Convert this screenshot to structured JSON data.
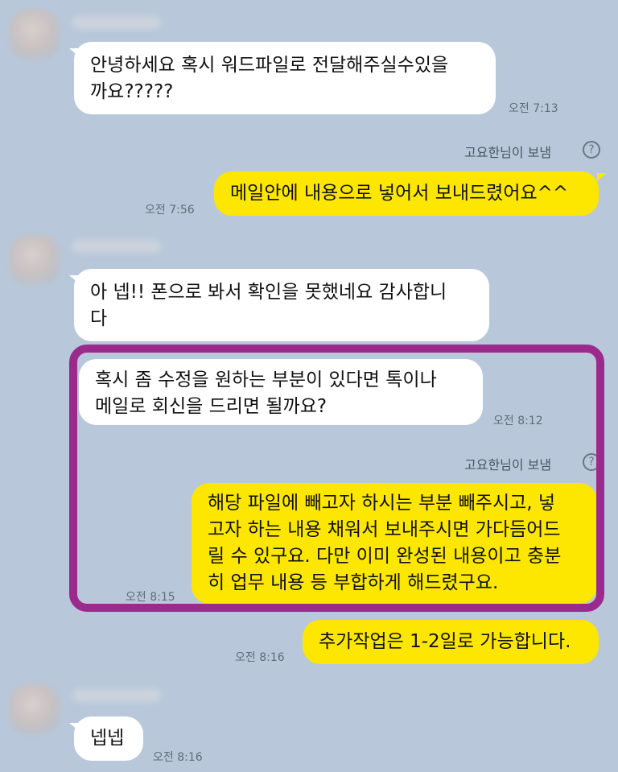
{
  "messages": {
    "m1": {
      "text": "안녕하세요 혹시 워드파일로 전달해주실수있을\n까요?????",
      "time": "오전 7:13"
    },
    "sent1": {
      "label": "고요한님이 보냄",
      "help": "?"
    },
    "m2": {
      "text": "메일안에 내용으로 넣어서 보내드렸어요^^",
      "time": "오전 7:56"
    },
    "m3": {
      "text": "아 넵!! 폰으로 봐서 확인을 못했네요 감사합니\n다"
    },
    "m4": {
      "text": "혹시 좀 수정을 원하는 부분이 있다면 톡이나\n메일로 회신을 드리면 될까요?",
      "time": "오전 8:12"
    },
    "sent2": {
      "label": "고요한님이 보냄",
      "help": "?"
    },
    "m5": {
      "text": "해당 파일에 빼고자 하시는 부분 빼주시고, 넣\n고자 하는 내용 채워서 보내주시면 가다듬어드\n릴 수 있구요. 다만 이미 완성된 내용이고 충분\n히 업무 내용 등 부합하게 해드렸구요.",
      "time": "오전 8:15"
    },
    "m6": {
      "text": "추가작업은 1-2일로 가능합니다.",
      "time": "오전 8:16"
    },
    "m7": {
      "text": "넵넵",
      "time": "오전 8:16"
    }
  },
  "colors": {
    "background": "#b8c8da",
    "received_bubble": "#ffffff",
    "sent_bubble": "#fde700",
    "highlight_border": "#9a2a8c"
  }
}
